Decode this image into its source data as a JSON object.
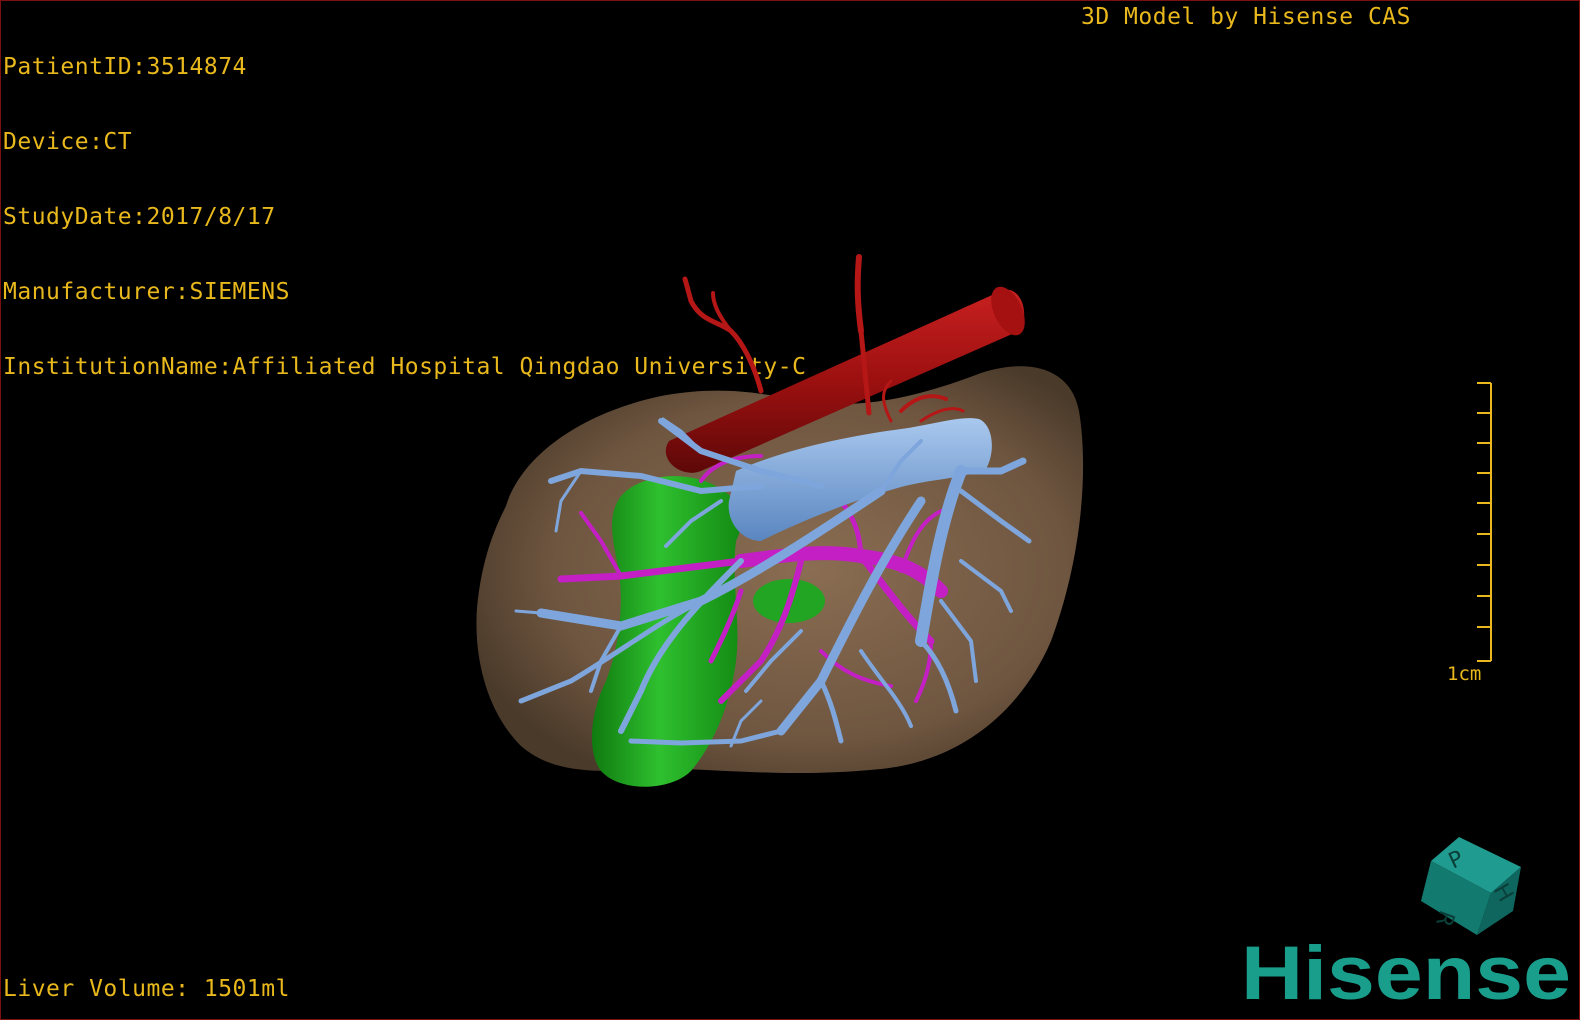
{
  "dicom_info": {
    "patient_id": "PatientID:3514874",
    "device": "Device:CT",
    "study_date": "StudyDate:2017/8/17",
    "manufacturer": "Manufacturer:SIEMENS",
    "institution": "InstitutionName:Affiliated Hospital Qingdao University-C"
  },
  "model_label": "3D Model by Hisense CAS",
  "liver_volume": "Liver Volume: 1501ml",
  "scale_bar": {
    "label": "1cm",
    "ticks": 10
  },
  "orientation_cube": {
    "faces": [
      "P",
      "H",
      "R"
    ]
  },
  "logo": {
    "text": "Hisense",
    "color": "#1a9e8c"
  },
  "structures": [
    {
      "name": "liver",
      "color": "#7a5f45"
    },
    {
      "name": "artery",
      "color": "#b41414"
    },
    {
      "name": "portal-vein",
      "color": "#c020c0"
    },
    {
      "name": "hepatic-vein",
      "color": "#6f9fd8"
    },
    {
      "name": "gallbladder",
      "color": "#1ca51c"
    }
  ]
}
